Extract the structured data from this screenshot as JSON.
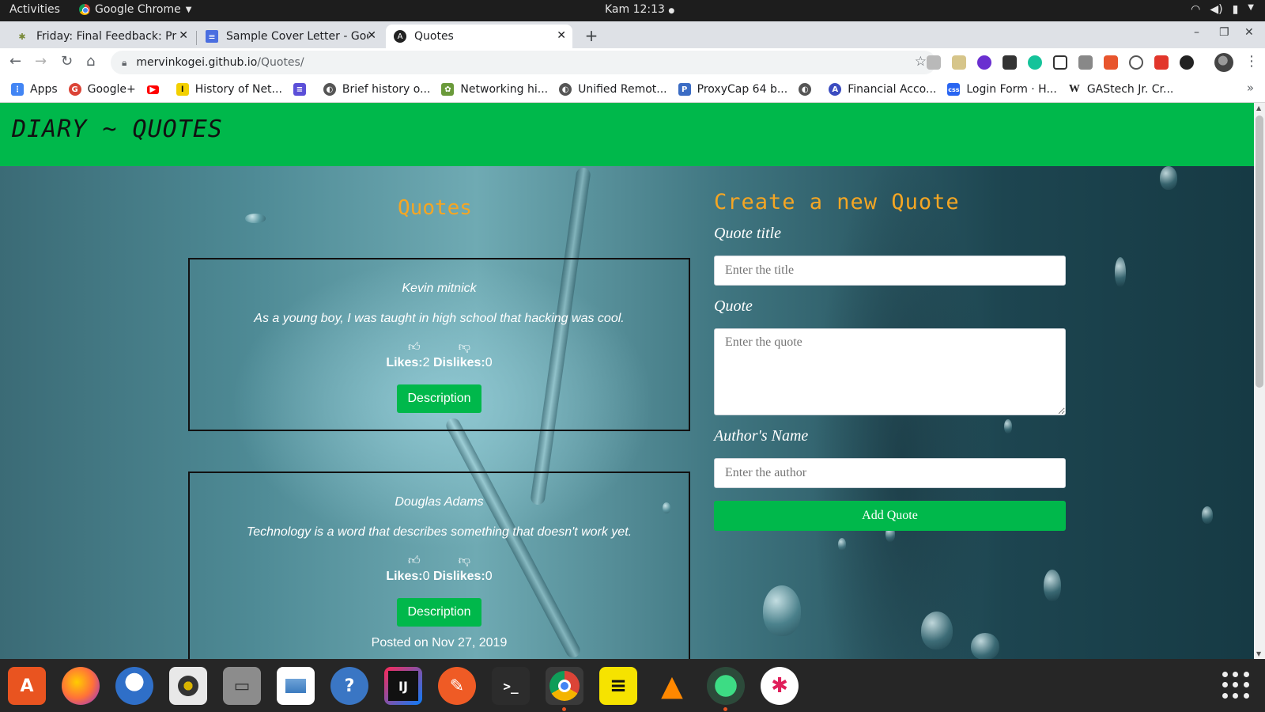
{
  "system_bar": {
    "activities": "Activities",
    "app_name": "Google Chrome",
    "clock": "Kam 12:13"
  },
  "tabs": [
    {
      "label": "Friday: Final Feedback: Pr",
      "icon": "palm-tree-icon"
    },
    {
      "label": "Sample Cover Letter - Goo",
      "icon": "google-docs-icon"
    },
    {
      "label": "Quotes",
      "icon": "angular-icon"
    }
  ],
  "address_bar": {
    "host": "mervinkogei.github.io",
    "path": "/Quotes/"
  },
  "bookmarks": [
    {
      "label": "Apps",
      "icon": "apps-grid-icon",
      "color": "#4285f4"
    },
    {
      "label": "Google+",
      "icon": "google-plus-icon",
      "color": "#db4437"
    },
    {
      "label": "",
      "icon": "youtube-icon",
      "color": "#ff0000"
    },
    {
      "label": "History of Net...",
      "icon": "bookmark-icon",
      "color": "#e6c200"
    },
    {
      "label": "",
      "icon": "docs-icon",
      "color": "#5b4fd8"
    },
    {
      "label": "Brief history o...",
      "icon": "globe-icon",
      "color": "#555555"
    },
    {
      "label": "Networking hi...",
      "icon": "network-icon",
      "color": "#6a9a3a"
    },
    {
      "label": "Unified Remot...",
      "icon": "globe-icon",
      "color": "#555555"
    },
    {
      "label": "ProxyCap 64 b...",
      "icon": "proxycap-icon",
      "color": "#3b6cc4"
    },
    {
      "label": "",
      "icon": "globe-icon",
      "color": "#555555"
    },
    {
      "label": "Financial Acco...",
      "icon": "financial-icon",
      "color": "#3b4cc0"
    },
    {
      "label": "Login Form · H...",
      "icon": "css-icon",
      "color": "#2965f1"
    },
    {
      "label": "GAStech Jr. Cr...",
      "icon": "wikipedia-icon",
      "color": "#222222"
    }
  ],
  "page": {
    "brand": "DIARY ~ QUOTES",
    "quotes_heading": "Quotes",
    "quotes": [
      {
        "author": "Kevin mitnick",
        "text": "As a young boy, I was taught in high school that hacking was cool.",
        "likes_label": "Likes:",
        "likes": "2",
        "dislikes_label": "Dislikes:",
        "dislikes": "0",
        "button": "Description"
      },
      {
        "author": "Douglas Adams",
        "text": "Technology is a word that describes something that doesn't work yet.",
        "likes_label": "Likes:",
        "likes": "0",
        "dislikes_label": "Dislikes:",
        "dislikes": "0",
        "button": "Description",
        "posted": "Posted on Nov 27, 2019"
      }
    ],
    "form": {
      "heading": "Create a new Quote",
      "title_label": "Quote title",
      "title_placeholder": "Enter the title",
      "quote_label": "Quote",
      "quote_placeholder": "Enter the quote",
      "author_label": "Author's Name",
      "author_placeholder": "Enter the author",
      "submit": "Add Quote"
    }
  },
  "colors": {
    "accent_green": "#00b84b",
    "heading_orange": "#f5a623"
  },
  "dock": [
    {
      "name": "ubuntu-software-icon",
      "color": "#e95420",
      "glyph": "A"
    },
    {
      "name": "firefox-icon",
      "color": "#ff7139",
      "glyph": ""
    },
    {
      "name": "thunderbird-icon",
      "color": "#2f6fc8",
      "glyph": ""
    },
    {
      "name": "rhythmbox-icon",
      "color": "#d9b300",
      "glyph": ""
    },
    {
      "name": "files-icon",
      "color": "#8c8c8c",
      "glyph": ""
    },
    {
      "name": "image-viewer-icon",
      "color": "#3b7bbf",
      "glyph": ""
    },
    {
      "name": "help-icon",
      "color": "#3a76c4",
      "glyph": "?"
    },
    {
      "name": "intellij-icon",
      "color": "#111111",
      "glyph": "IJ"
    },
    {
      "name": "postman-icon",
      "color": "#ef5b25",
      "glyph": ""
    },
    {
      "name": "terminal-icon",
      "color": "#2c2c2c",
      "glyph": ">_"
    },
    {
      "name": "chrome-icon",
      "color": "#4285f4",
      "glyph": ""
    },
    {
      "name": "notes-icon",
      "color": "#f6e300",
      "glyph": ""
    },
    {
      "name": "vlc-icon",
      "color": "#ff8800",
      "glyph": ""
    },
    {
      "name": "android-studio-icon",
      "color": "#3ddc84",
      "glyph": ""
    },
    {
      "name": "slack-icon",
      "color": "#ffffff",
      "glyph": ""
    }
  ]
}
